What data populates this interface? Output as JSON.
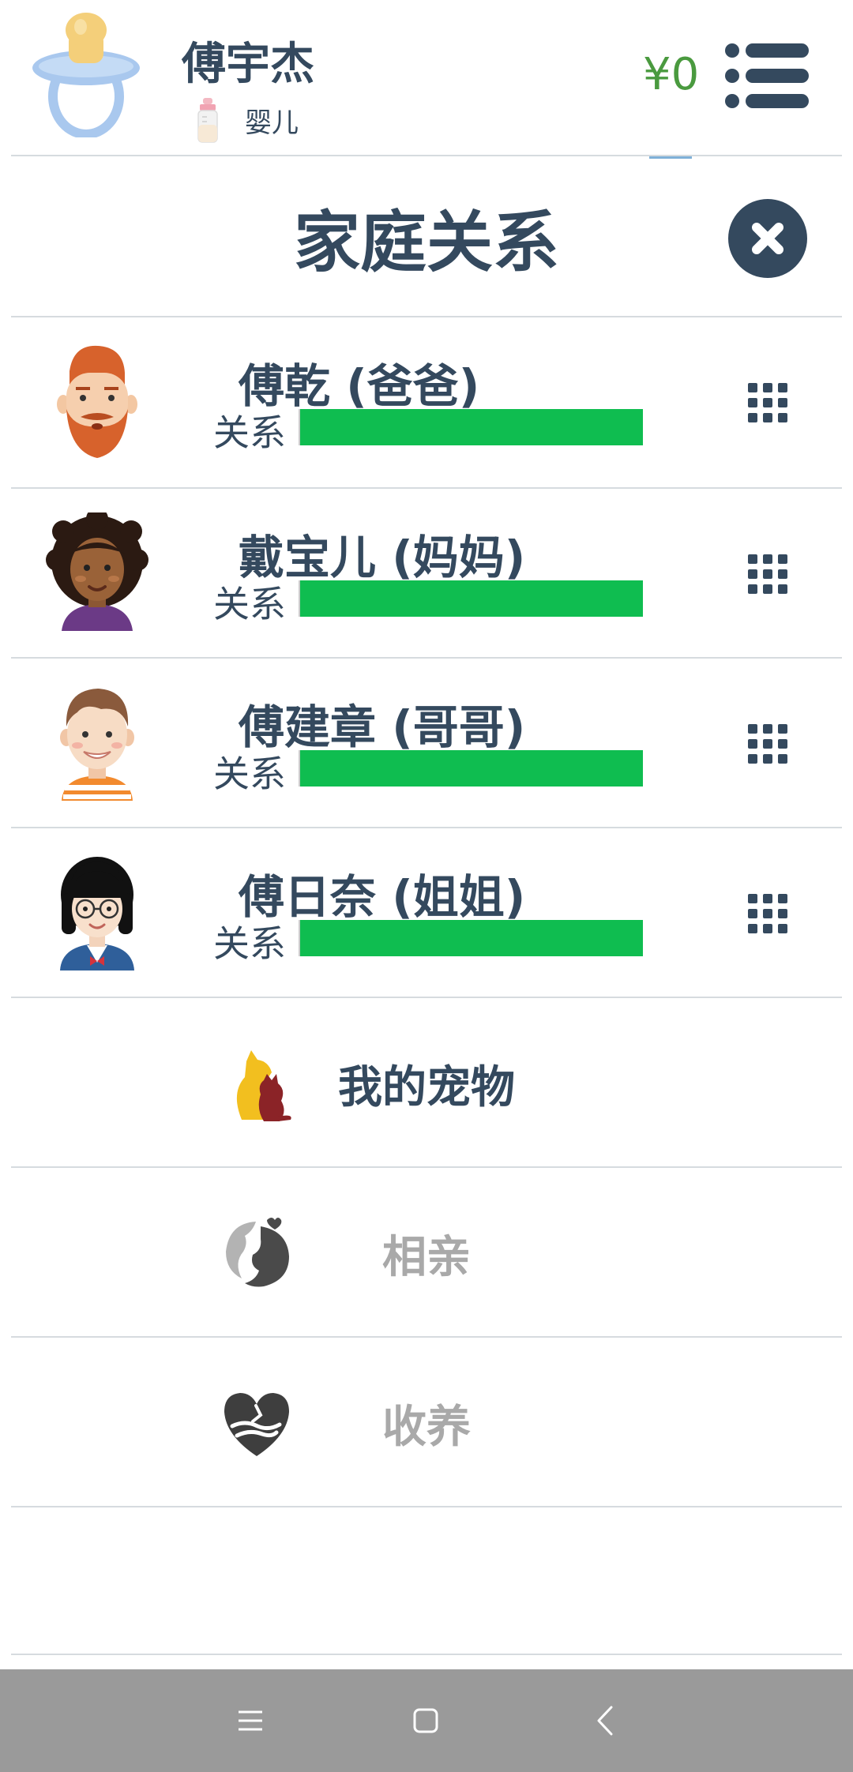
{
  "header": {
    "player_name": "傅宇杰",
    "stage": "婴儿",
    "money": "¥0",
    "avatar_icon": "pacifier-icon",
    "stage_icon": "baby-bottle-icon",
    "menu_icon": "list-menu-icon"
  },
  "panel": {
    "title": "家庭关系",
    "close_icon": "close-icon"
  },
  "members": [
    {
      "name": "傅乾 (爸爸)",
      "rel_label": "关系",
      "relationship": 1.0,
      "avatar": "bearded-man-avatar"
    },
    {
      "name": "戴宝儿 (妈妈)",
      "rel_label": "关系",
      "relationship": 1.0,
      "avatar": "curly-hair-woman-avatar"
    },
    {
      "name": "傅建章 (哥哥)",
      "rel_label": "关系",
      "relationship": 1.0,
      "avatar": "boy-avatar"
    },
    {
      "name": "傅日奈 (姐姐)",
      "rel_label": "关系",
      "relationship": 1.0,
      "avatar": "girl-with-glasses-avatar"
    }
  ],
  "actions": [
    {
      "label": "我的宠物",
      "icon": "pets-icon",
      "enabled": true
    },
    {
      "label": "相亲",
      "icon": "matchmaking-icon",
      "enabled": false
    },
    {
      "label": "收养",
      "icon": "adoption-icon",
      "enabled": false
    }
  ],
  "colors": {
    "text": "#34495e",
    "money": "#4a9a3f",
    "bar": "#0fbd50",
    "disabled": "#a9a9a9",
    "navbar": "#9a9a9a"
  },
  "navbar": {
    "recent_icon": "recent-apps-icon",
    "home_icon": "home-icon",
    "back_icon": "back-icon"
  }
}
